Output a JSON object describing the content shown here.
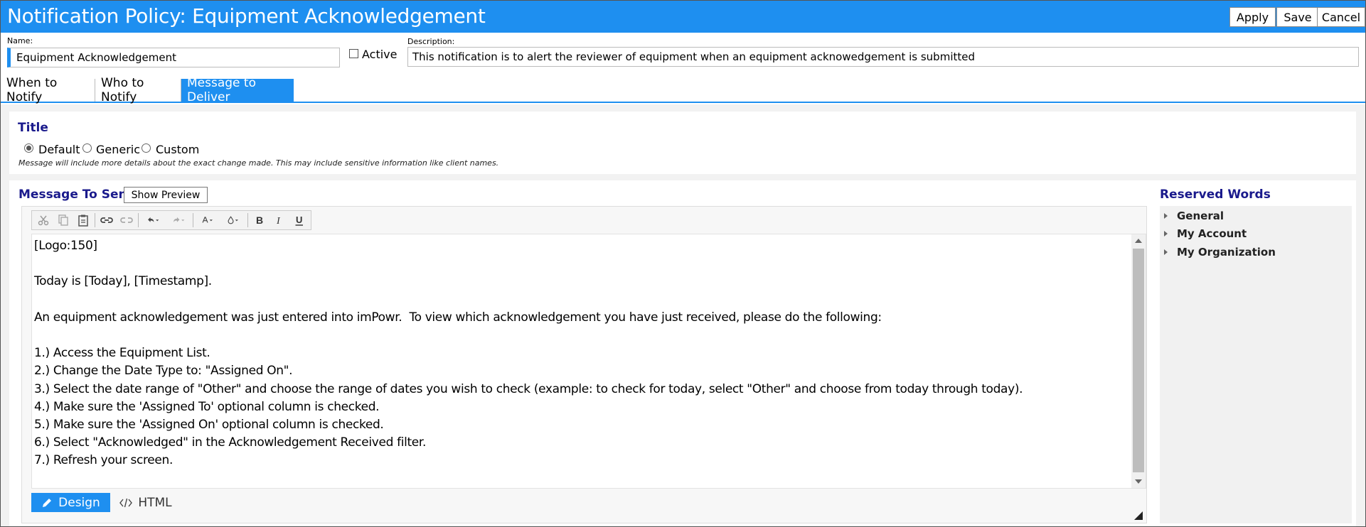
{
  "header": {
    "title": "Notification Policy: Equipment Acknowledgement",
    "apply_label": "Apply",
    "save_label": "Save",
    "cancel_label": "Cancel",
    "color": "#1e8ff0"
  },
  "form": {
    "name_label": "Name:",
    "name_value": "Equipment Acknowledgement",
    "active_label": "Active",
    "active_checked": false,
    "description_label": "Description:",
    "description_value": "This notification is to alert the reviewer of equipment when an equipment acknowedgement is submitted"
  },
  "tabs": [
    {
      "label": "When to Notify",
      "active": false
    },
    {
      "label": "Who to Notify",
      "active": false
    },
    {
      "label": "Message to Deliver",
      "active": true
    }
  ],
  "title_section": {
    "heading": "Title",
    "options": [
      {
        "label": "Default",
        "selected": true
      },
      {
        "label": "Generic",
        "selected": false
      },
      {
        "label": "Custom",
        "selected": false
      }
    ],
    "note": "Message will include more details about the exact change made. This may include sensitive information like client names."
  },
  "message_section": {
    "heading": "Message To Send",
    "show_preview_label": "Show Preview",
    "toolbar_icons": [
      "cut-icon",
      "copy-icon",
      "paste-icon",
      "link-icon",
      "unlink-icon",
      "undo-icon",
      "redo-icon",
      "font-color-icon",
      "background-color-icon",
      "bold-icon",
      "italic-icon",
      "underline-icon"
    ],
    "body": "[Logo:150]\n\nToday is [Today], [Timestamp].\n\nAn equipment acknowledgement was just entered into imPowr.  To view which acknowledgement you have just received, please do the following:\n\n1.) Access the Equipment List.\n2.) Change the Date Type to: \"Assigned On\".\n3.) Select the date range of \"Other\" and choose the range of dates you wish to check (example: to check for today, select \"Other\" and choose from today through today).\n4.) Make sure the 'Assigned To' optional column is checked.\n5.) Make sure the 'Assigned On' optional column is checked.\n6.) Select \"Acknowledged\" in the Acknowledgement Received filter.\n7.) Refresh your screen.",
    "design_label": "Design",
    "html_label": "HTML"
  },
  "reserved_words": {
    "heading": "Reserved Words",
    "items": [
      "General",
      "My Account",
      "My Organization"
    ]
  }
}
